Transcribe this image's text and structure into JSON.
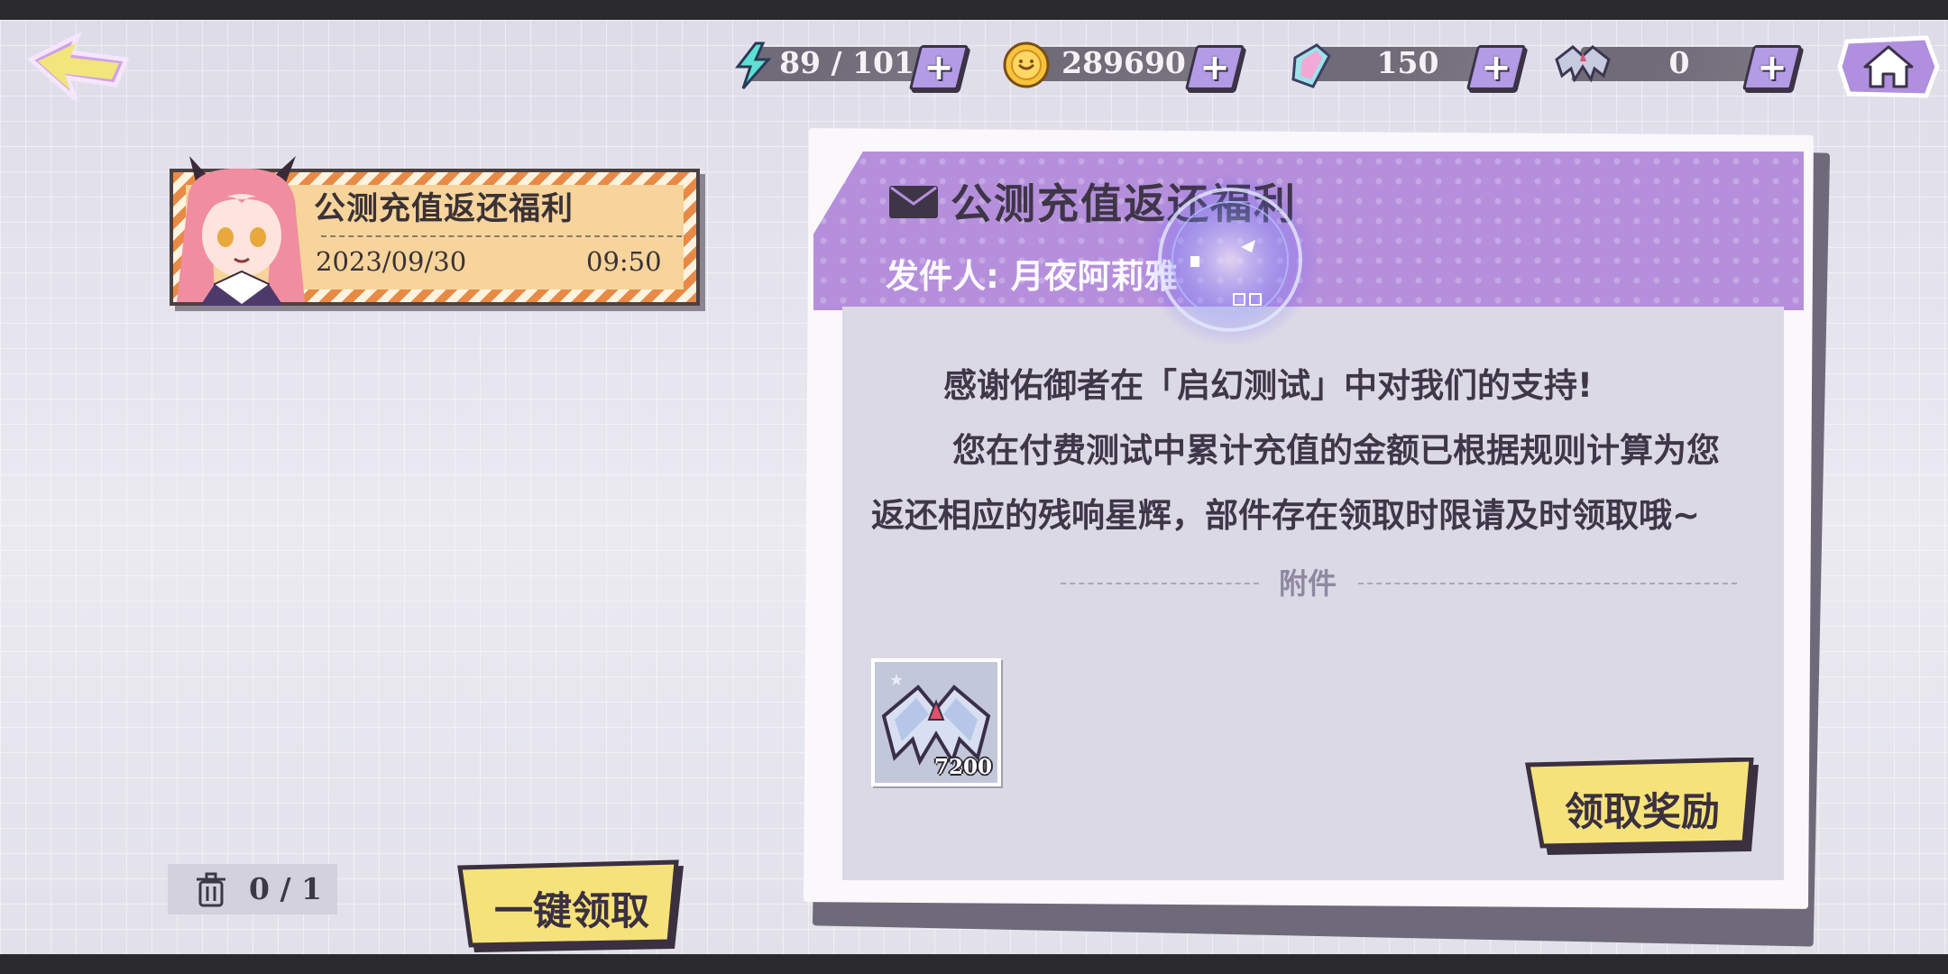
{
  "topbar": {
    "resources": [
      {
        "name": "stamina",
        "icon": "lightning-icon",
        "value": "89 / 101"
      },
      {
        "name": "coins",
        "icon": "coin-icon",
        "value": "289690"
      },
      {
        "name": "crystals",
        "icon": "crystal-icon",
        "value": "150"
      },
      {
        "name": "starglow",
        "icon": "bat-wing-icon",
        "value": "0"
      }
    ],
    "plus_label": "+"
  },
  "mail_list": [
    {
      "title": "公测充值返还福利",
      "date": "2023/09/30",
      "time": "09:50"
    }
  ],
  "mail_count": "0 / 1",
  "claim_all_label": "一键领取",
  "detail": {
    "title": "公测充值返还福利",
    "sender": "发件人: 月夜阿莉雅",
    "body_line1": "感谢佑御者在「启幻测试」中对我们的支持!",
    "body_line2": "您在付费测试中累计充值的金额已根据规则计算为您返还相应的残响星辉，部件存在领取时限请及时领取哦~",
    "attachment_label": "附件",
    "attachments": [
      {
        "icon": "bat-wing-icon",
        "quantity": "7200"
      }
    ],
    "claim_label": "领取奖励"
  },
  "colors": {
    "accent_purple": "#b58fdc",
    "button_yellow": "#f6e27a",
    "mail_card": "#f3cd90",
    "dark_outline": "#3b3346"
  }
}
